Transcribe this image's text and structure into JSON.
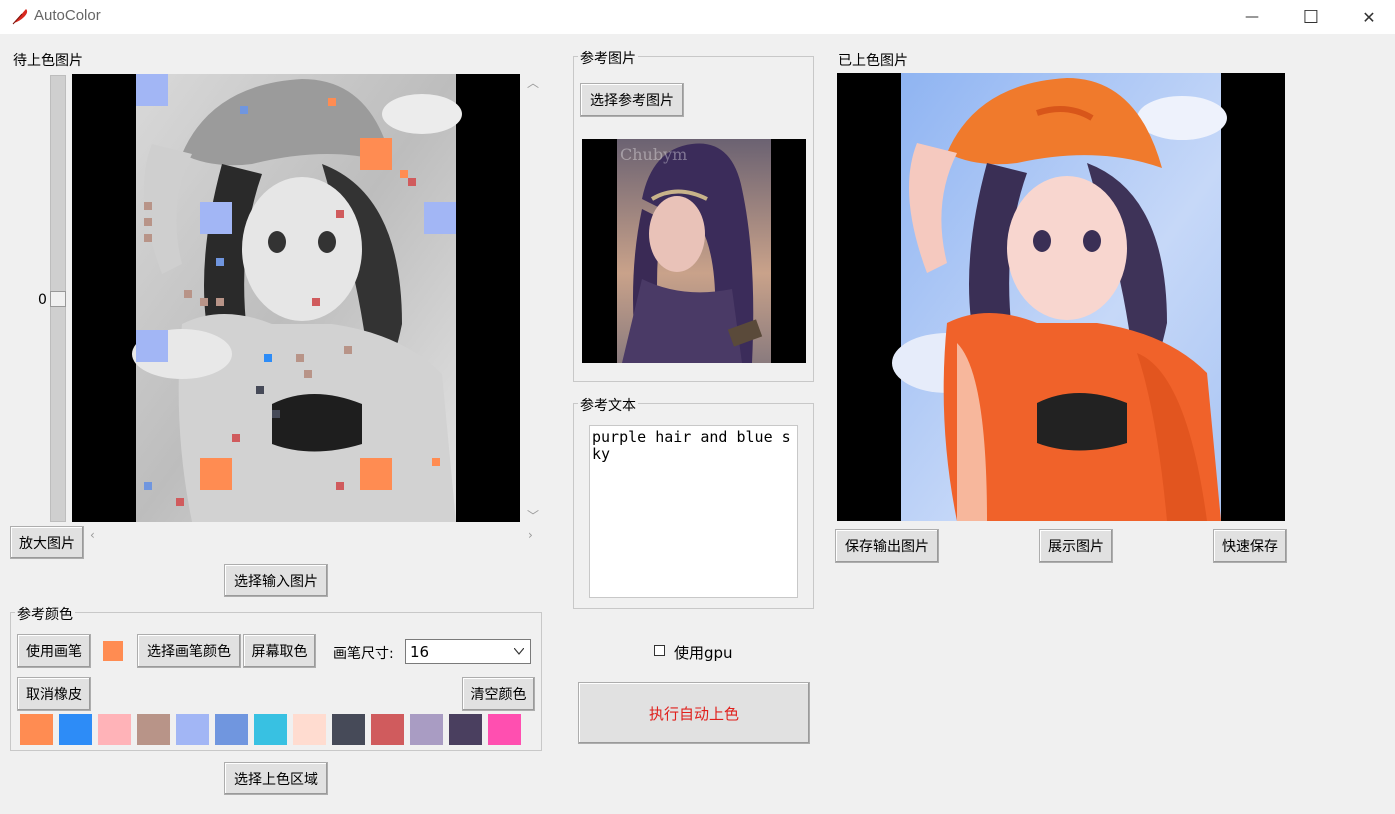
{
  "window": {
    "title": "AutoColor",
    "minimize_glyph": "—",
    "maximize_glyph": "☐",
    "close_glyph": "✕"
  },
  "left": {
    "heading": "待上色图片",
    "slider_value": "0",
    "zoom_button": "放大图片",
    "select_input_button": "选择输入图片",
    "select_region_button": "选择上色区域"
  },
  "ref_colors": {
    "title": "参考颜色",
    "use_brush": "使用画笔",
    "current_color": "#ff8c52",
    "choose_brush_color": "选择画笔颜色",
    "screen_pick": "屏幕取色",
    "brush_size_label": "画笔尺寸:",
    "brush_size_value": "16",
    "cancel_eraser": "取消橡皮",
    "clear_colors": "清空颜色",
    "palette": [
      "#ff8c52",
      "#2d8cf7",
      "#ffb3b8",
      "#b89488",
      "#a2b6f5",
      "#7096df",
      "#38c1e2",
      "#ffdcd0",
      "#464a58",
      "#d05b5d",
      "#a99cc3",
      "#4a3f5f",
      "#ff4fb0"
    ]
  },
  "middle": {
    "ref_image_title": "参考图片",
    "choose_ref_button": "选择参考图片",
    "watermark": "Chubym",
    "ref_text_title": "参考文本",
    "ref_text_value": "purple hair and blue sky",
    "use_gpu_label": "使用gpu",
    "run_button": "执行自动上色",
    "run_color": "#e0201c"
  },
  "right": {
    "heading": "已上色图片",
    "save_output": "保存输出图片",
    "show_image": "展示图片",
    "quick_save": "快速保存"
  }
}
